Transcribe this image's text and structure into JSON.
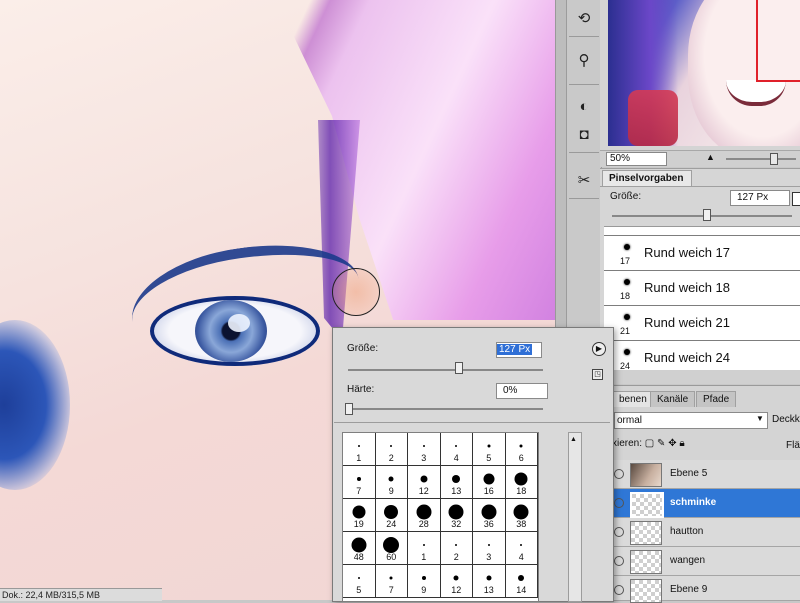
{
  "canvas": {
    "status": "Dok.: 22,4 MB/315,5 MB"
  },
  "navigator": {
    "zoom": "50%"
  },
  "brush_presets": {
    "tab": "Pinselvorgaben",
    "size_label": "Größe:",
    "size_value": "127 Px",
    "size_slider_fraction": 0.5,
    "items": [
      {
        "num": "17",
        "name": "Rund weich 17"
      },
      {
        "num": "18",
        "name": "Rund weich 18"
      },
      {
        "num": "21",
        "name": "Rund weich 21"
      },
      {
        "num": "24",
        "name": "Rund weich 24"
      }
    ]
  },
  "picker": {
    "size_label": "Größe:",
    "size_value": "127 Px",
    "hardness_label": "Härte:",
    "hardness_value": "0%",
    "hardness_fraction": 0,
    "brushes": [
      {
        "label": "1",
        "d": 2
      },
      {
        "label": "2",
        "d": 2
      },
      {
        "label": "3",
        "d": 2
      },
      {
        "label": "4",
        "d": 2
      },
      {
        "label": "5",
        "d": 3
      },
      {
        "label": "6",
        "d": 3
      },
      {
        "label": "7",
        "d": 4
      },
      {
        "label": "9",
        "d": 5
      },
      {
        "label": "12",
        "d": 7
      },
      {
        "label": "13",
        "d": 8
      },
      {
        "label": "16",
        "d": 11
      },
      {
        "label": "18",
        "d": 13
      },
      {
        "label": "19",
        "d": 13
      },
      {
        "label": "24",
        "d": 14
      },
      {
        "label": "28",
        "d": 15
      },
      {
        "label": "32",
        "d": 15
      },
      {
        "label": "36",
        "d": 15
      },
      {
        "label": "38",
        "d": 15
      },
      {
        "label": "48",
        "d": 15
      },
      {
        "label": "60",
        "d": 16
      },
      {
        "label": "1",
        "d": 2
      },
      {
        "label": "2",
        "d": 2
      },
      {
        "label": "3",
        "d": 2
      },
      {
        "label": "4",
        "d": 2
      },
      {
        "label": "5",
        "d": 2
      },
      {
        "label": "7",
        "d": 3
      },
      {
        "label": "9",
        "d": 4
      },
      {
        "label": "12",
        "d": 5
      },
      {
        "label": "13",
        "d": 5
      },
      {
        "label": "14",
        "d": 6
      }
    ]
  },
  "layers": {
    "tabs": [
      "benen",
      "Kanäle",
      "Pfade"
    ],
    "blend_mode": "ormal",
    "opacity_label": "Deckk",
    "lock_label": "xieren:",
    "fill_label": "Flä",
    "items": [
      {
        "name": "Ebene 5",
        "selected": false,
        "thumb": "photo"
      },
      {
        "name": "schminke",
        "selected": true,
        "thumb": "transparent"
      },
      {
        "name": "hautton",
        "selected": false,
        "thumb": "transparent"
      },
      {
        "name": "wangen",
        "selected": false,
        "thumb": "transparent"
      },
      {
        "name": "Ebene 9",
        "selected": false,
        "thumb": "transparent"
      }
    ]
  },
  "icons": {
    "tools": [
      "history-brush-icon",
      "clone-stamp-icon",
      "color-icon",
      "mask-icon",
      "tools-icon"
    ]
  }
}
